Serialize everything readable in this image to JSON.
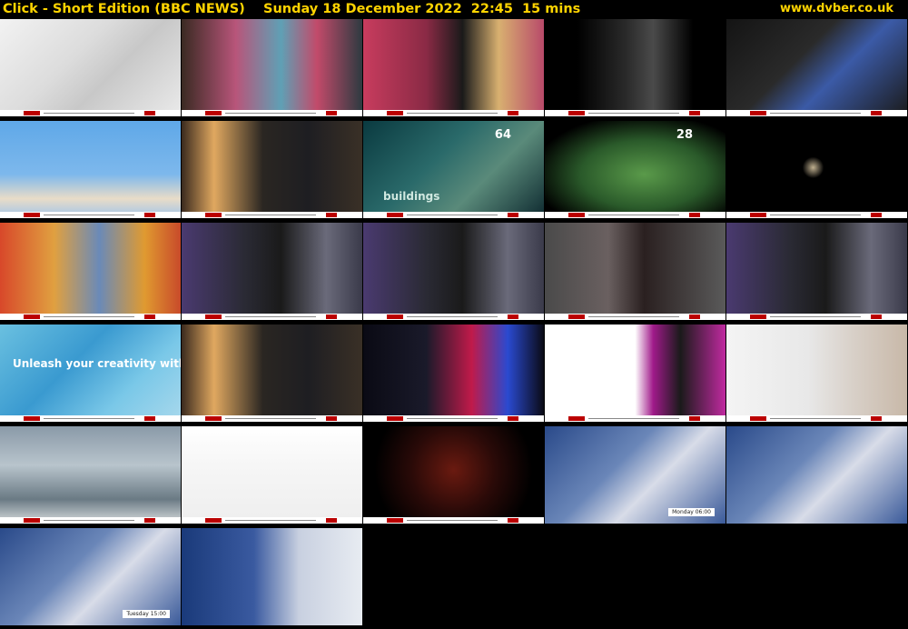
{
  "header": {
    "title": "Click - Short Edition (BBC NEWS)    Sunday 18 December 2022  22:45  15 mins",
    "site": "www.dvber.co.uk"
  },
  "colors": {
    "header_text": "#ffd400",
    "background": "#000000"
  },
  "thumbnails": [
    {
      "scene": "magazine-pages",
      "bg": "linear-gradient(135deg,#f2f2f2 0%,#dcdcdc 40%,#c8c8c8 60%,#eaeaea 100%)",
      "ticker": true
    },
    {
      "scene": "crochet-tree",
      "bg": "linear-gradient(90deg,#3a2a22 0%,#b8557a 30%,#5fa0b5 55%,#c24a6a 75%,#2d3a40 100%)",
      "ticker": true
    },
    {
      "scene": "presenters-art",
      "bg": "linear-gradient(90deg,#c83c5e 0%,#8a2a45 35%,#1a1a1a 55%,#d8b070 75%,#b84a6a 100%)",
      "ticker": true
    },
    {
      "scene": "dalle-bird",
      "bg": "linear-gradient(90deg,#000 0%,#000 18%,#2a2a2a 45%,#4a4a4a 60%,#000 82%)",
      "ticker": true
    },
    {
      "scene": "laptop-dog-image",
      "bg": "linear-gradient(135deg,#141414 0%,#2a2a2a 40%,#3b5aa6 60%,#1a1a1a 100%)",
      "ticker": true
    },
    {
      "scene": "sky-feather",
      "bg": "linear-gradient(180deg,#5fa8e8 0%,#7db8ec 55%,#e8dcc8 80%,#9fc4ea 100%)",
      "ticker": true
    },
    {
      "scene": "presenter-studio",
      "bg": "linear-gradient(90deg,#3a2a1e 0%,#e0a860 18%,#2a2622 45%,#1e1e22 70%,#3a3026 100%)",
      "ticker": true
    },
    {
      "scene": "city-buildings",
      "bg": "linear-gradient(135deg,#0a3a40 0%,#2a6a6a 40%,#5a8a7a 65%,#0e2a30 100%)",
      "ticker": true,
      "overlay": "64",
      "caption": "buildings"
    },
    {
      "scene": "green-glow",
      "bg": "radial-gradient(ellipse at 55% 55%,#5a9a4a 0%,#2a5a2a 45%,#000 80%)",
      "ticker": true,
      "overlay": "28"
    },
    {
      "scene": "dark-object",
      "bg": "radial-gradient(circle at 48% 48%,#c0b090 0%,#000 10%,#000 100%)",
      "ticker": true
    },
    {
      "scene": "abstract-painting",
      "bg": "linear-gradient(90deg,#d8482a 0%,#e0a040 30%,#6a8ab8 55%,#e09a30 80%,#c84a2a 100%)",
      "ticker": true
    },
    {
      "scene": "vlogger",
      "bg": "linear-gradient(90deg,#4a3a70 0%,#2a2a34 35%,#1a1a1a 55%,#6a6a7a 80%,#3a3a4a 100%)",
      "ticker": true
    },
    {
      "scene": "vlogger",
      "bg": "linear-gradient(90deg,#4a3a70 0%,#2a2a34 35%,#1a1a1a 55%,#6a6a7a 80%,#3a3a4a 100%)",
      "ticker": true
    },
    {
      "scene": "interviewee",
      "bg": "linear-gradient(90deg,#4a4a4a 0%,#6a6060 35%,#2a2020 55%,#5a5a5a 100%)",
      "ticker": true
    },
    {
      "scene": "vlogger",
      "bg": "linear-gradient(90deg,#4a3a70 0%,#2a2a34 35%,#1a1a1a 55%,#6a6a7a 80%,#3a3a4a 100%)",
      "ticker": true
    },
    {
      "scene": "adobe-screen",
      "bg": "linear-gradient(135deg,#6ac0e0 0%,#3a9ad0 40%,#7ac8e8 70%,#a8d8ec 100%)",
      "ticker": true,
      "overlay": "Unleash your creativity with un"
    },
    {
      "scene": "presenter-studio",
      "bg": "linear-gradient(90deg,#3a2a1e 0%,#e0a860 18%,#2a2622 45%,#1e1e22 70%,#3a3026 100%)",
      "ticker": true
    },
    {
      "scene": "robot-neon",
      "bg": "linear-gradient(90deg,#0a0a14 0%,#1a1a2a 35%,#c01a4a 60%,#2a4ad0 80%,#0a0a14 100%)",
      "ticker": true
    },
    {
      "scene": "chatgpt-page",
      "bg": "linear-gradient(90deg,#ffffff 0%,#ffffff 50%,#a01a8a 60%,#1a1a1a 75%,#c02aa0 100%)",
      "ticker": true
    },
    {
      "scene": "woman-laptop",
      "bg": "linear-gradient(90deg,#f4f4f4 0%,#e8e8e8 45%,#d8d0c8 70%,#c8b8a8 100%)",
      "ticker": true
    },
    {
      "scene": "atrium",
      "bg": "linear-gradient(180deg,#8a9aa8 0%,#b8c4cc 40%,#6a7a84 75%,#d8dcde 100%)",
      "ticker": true
    },
    {
      "scene": "chatgpt-dialog",
      "bg": "linear-gradient(180deg,#ffffff 0%,#f6f6f6 40%,#eeeeee 100%)",
      "ticker": true
    },
    {
      "scene": "click-logo",
      "bg": "radial-gradient(circle at 50% 45%,#6a1a10 0%,#2a0a08 40%,#000 75%)",
      "ticker": true
    },
    {
      "scene": "weather-map",
      "bg": "linear-gradient(135deg,#2a4a8a 0%,#6a86b8 40%,#d8dce8 60%,#3a5a9a 100%)",
      "ticker": false,
      "caption": "Monday 06:00"
    },
    {
      "scene": "weather-map",
      "bg": "linear-gradient(135deg,#2a4a8a 0%,#6a86b8 40%,#d8dce8 60%,#3a5a9a 100%)",
      "ticker": false
    },
    {
      "scene": "weather-map",
      "bg": "linear-gradient(135deg,#2a4a8a 0%,#6a86b8 40%,#d8dce8 60%,#3a5a9a 100%)",
      "ticker": false,
      "caption": "Tuesday 15:00"
    },
    {
      "scene": "weather-forecast",
      "bg": "linear-gradient(90deg,#1a3a7a 0%,#3a5aa0 40%,#c8d0e0 65%,#e8ecf2 100%)",
      "ticker": false
    },
    {
      "scene": "blank",
      "bg": "#000",
      "ticker": false
    },
    {
      "scene": "blank",
      "bg": "#000",
      "ticker": false
    },
    {
      "scene": "blank",
      "bg": "#000",
      "ticker": false
    }
  ]
}
